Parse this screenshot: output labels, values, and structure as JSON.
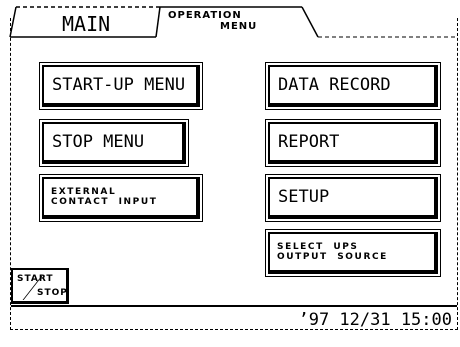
{
  "tabs": {
    "main": "MAIN",
    "operation_line1": "OPERATION",
    "operation_line2": "MENU"
  },
  "buttons": {
    "startup_menu": "START-UP MENU",
    "stop_menu": "STOP MENU",
    "external_line1": "EXTERNAL",
    "external_line2": "CONTACT  INPUT",
    "data_record": "DATA RECORD",
    "report": "REPORT",
    "setup": "SETUP",
    "select_line1": "SELECT  UPS",
    "select_line2": "OUTPUT  SOURCE"
  },
  "start_stop": {
    "top": "START",
    "bottom": "STOP"
  },
  "status": {
    "datetime": "’97 12/31 15:00"
  }
}
